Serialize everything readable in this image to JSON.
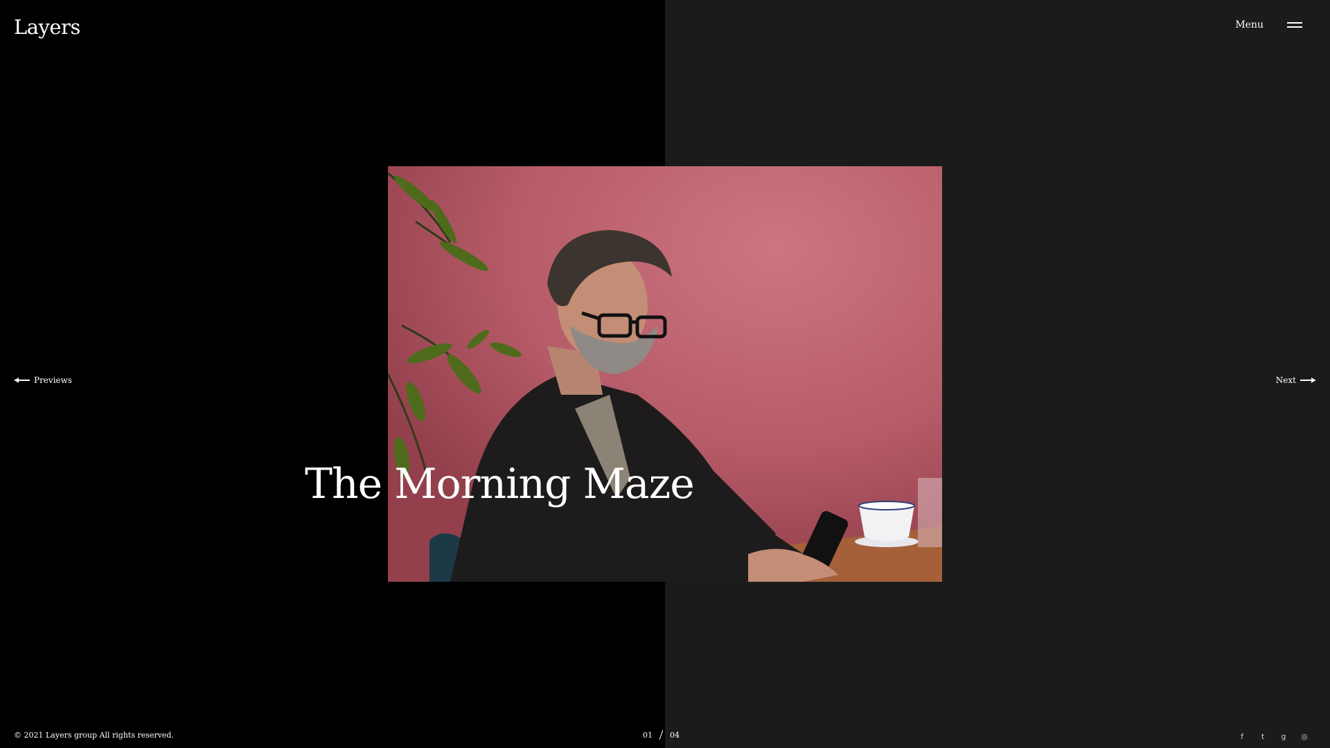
{
  "header": {
    "logo": "Layers",
    "menu_label": "Menu"
  },
  "slide": {
    "title": "The Morning Maze",
    "image_icon": "photo-portrait-man-phone"
  },
  "nav": {
    "prev_label": "Previews",
    "next_label": "Next"
  },
  "pager": {
    "current": "01",
    "total": "04"
  },
  "footer": {
    "copyright": "© 2021 Layers group All rights reserved."
  },
  "socials": [
    {
      "icon": "facebook-icon",
      "glyph": "f"
    },
    {
      "icon": "twitter-icon",
      "glyph": "t"
    },
    {
      "icon": "google-plus-icon",
      "glyph": "g"
    },
    {
      "icon": "instagram-icon",
      "glyph": "◎"
    }
  ],
  "colors": {
    "left_bg": "#000000",
    "right_bg": "#1b1b1b",
    "photo_wall": "#c2656f"
  }
}
